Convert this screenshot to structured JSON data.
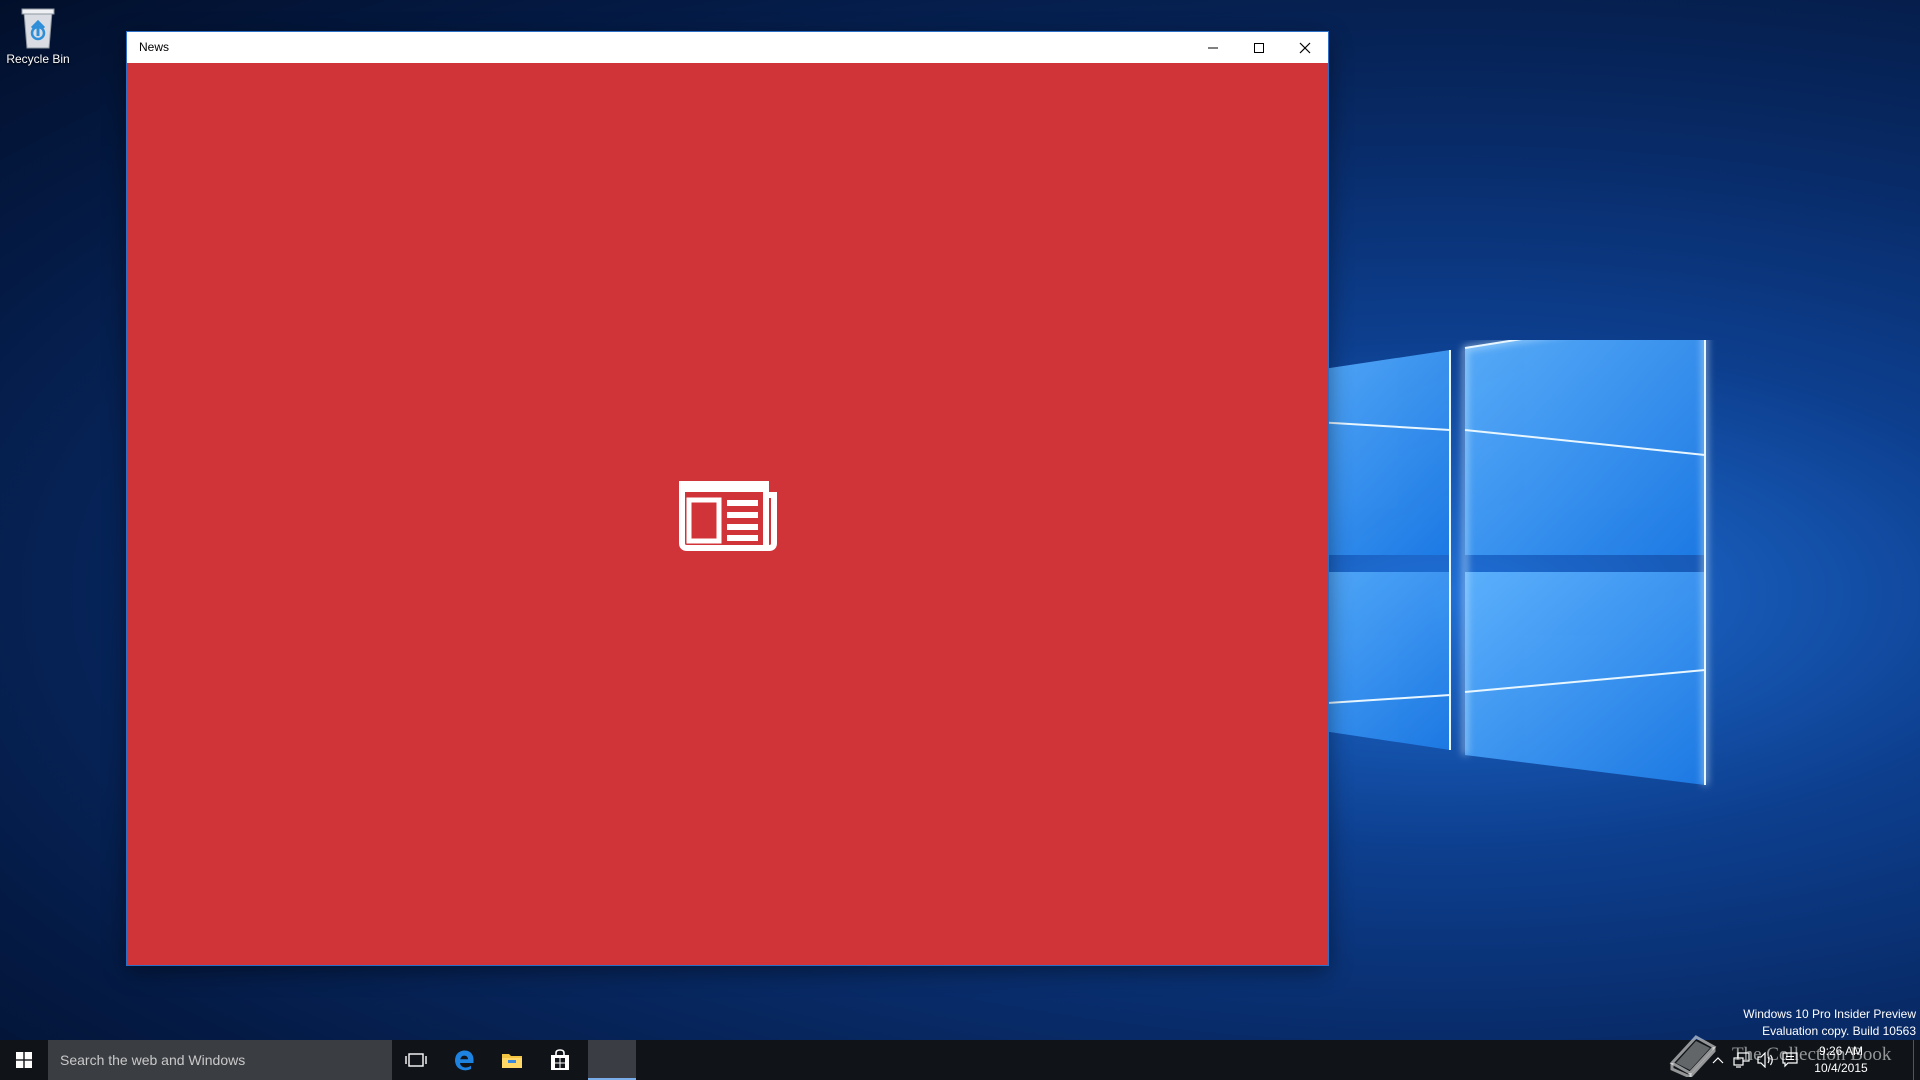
{
  "desktop": {
    "icons": [
      {
        "label": "Recycle Bin",
        "icon": "recycle-bin-icon"
      }
    ],
    "watermark": {
      "line1": "Windows 10 Pro Insider Preview",
      "line2": "Evaluation copy. Build 10563"
    },
    "overlay_watermark": "The Collection Book"
  },
  "window": {
    "title": "News",
    "splash_icon": "newspaper-icon",
    "background_color": "#d13438",
    "controls": {
      "minimize": "minimize-icon",
      "maximize": "maximize-icon",
      "close": "close-icon"
    }
  },
  "taskbar": {
    "search_placeholder": "Search the web and Windows",
    "pinned": [
      "task-view-icon",
      "edge-icon",
      "file-explorer-icon",
      "store-icon"
    ],
    "running": [
      "news-app"
    ],
    "tray": {
      "time": "9:26 AM",
      "date": "10/4/2015"
    }
  },
  "colors": {
    "accent": "#0078d7",
    "taskbar": "#101418",
    "app_red": "#d13438"
  }
}
